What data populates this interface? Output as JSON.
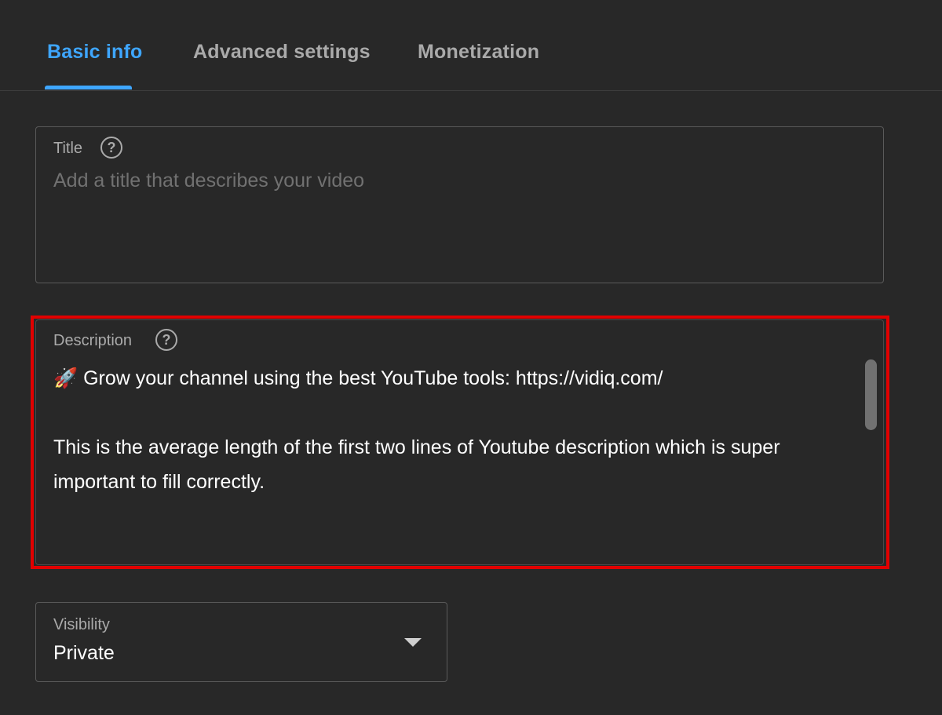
{
  "tabs": [
    {
      "label": "Basic info",
      "active": true
    },
    {
      "label": "Advanced settings",
      "active": false
    },
    {
      "label": "Monetization",
      "active": false
    }
  ],
  "title_field": {
    "label": "Title",
    "help_icon": "?",
    "value": "",
    "placeholder": "Add a title that describes your video"
  },
  "description_field": {
    "label": "Description",
    "help_icon": "?",
    "line1_icon": "🚀",
    "line1_text": "Grow your channel using the best YouTube tools: https://vidiq.com/",
    "body": "This is the average length of the first two lines of Youtube description which is super important to fill correctly."
  },
  "visibility_field": {
    "label": "Visibility",
    "value": "Private"
  },
  "colors": {
    "background": "#282828",
    "accent": "#3ea6ff",
    "highlight": "#e10000",
    "border": "#5a5a5a",
    "muted_text": "#aaaaaa"
  }
}
